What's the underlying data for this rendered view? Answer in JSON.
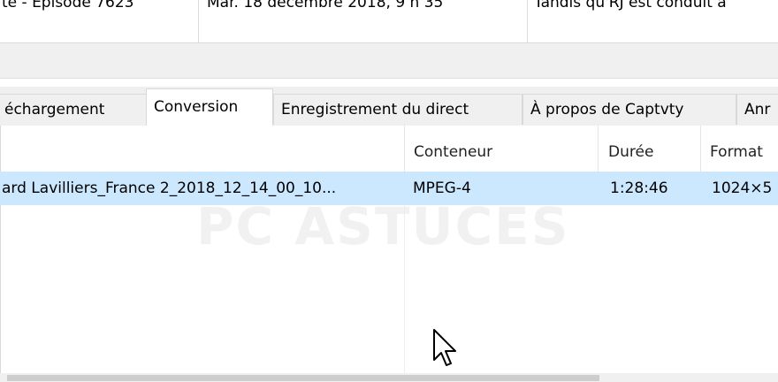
{
  "top_list": {
    "row1": {
      "c1": "te - Episode 7623",
      "c2": "Mar. 18 décembre 2018, 9 h 35",
      "c3": "Tandis qu'RJ est conduit a"
    },
    "row2": {
      "c1": "· - · · · - - - - - · ·",
      "c2": "· · · · · · · · · · · · · · · · · · · · ·",
      "c3": "· · · · · · · · · · · · ·"
    }
  },
  "tabs": [
    {
      "label": "échargement"
    },
    {
      "label": "Conversion"
    },
    {
      "label": "Enregistrement du direct"
    },
    {
      "label": "À propos de Captvty"
    },
    {
      "label": "Anr"
    }
  ],
  "columns": [
    {
      "label": ""
    },
    {
      "label": "Conteneur"
    },
    {
      "label": "Durée"
    },
    {
      "label": "Format"
    }
  ],
  "rows": [
    {
      "name": "ard Lavilliers_France 2_2018_12_14_00_10...",
      "container": "MPEG-4",
      "duration": "1:28:46",
      "format": "1024×5"
    }
  ],
  "watermark": "PC ASTUCES",
  "colors": {
    "selection": "#cce8ff",
    "tab_bg": "#f0f0f0",
    "border": "#d9d9d9"
  }
}
